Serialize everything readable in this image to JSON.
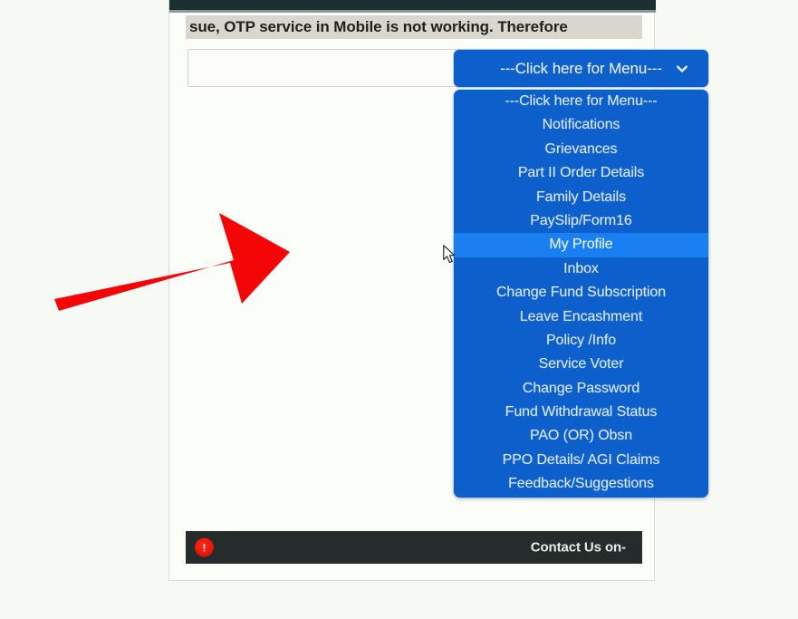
{
  "page": {
    "background_color": "#f7faf4",
    "frame_color": "#fbfdf8"
  },
  "top_strip": {
    "color": "#18302f"
  },
  "marquee": {
    "text": "sue, OTP service in Mobile is not working. Therefore",
    "background_color": "#d9d7cd",
    "text_color": "#20211e"
  },
  "select": {
    "label": "---Click here for Menu---",
    "chevron_icon": "chevron-down-icon",
    "background_color": "#0d5fcb",
    "text_color": "#e9f2fd",
    "expanded": true
  },
  "dropdown": {
    "background_color": "#0d5fcb",
    "highlight_color": "#1a7ff0",
    "selected_index": 6,
    "options": [
      {
        "label": "---Click here for Menu---"
      },
      {
        "label": "Notifications"
      },
      {
        "label": "Grievances"
      },
      {
        "label": "Part II Order Details"
      },
      {
        "label": "Family Details"
      },
      {
        "label": "PaySlip/Form16"
      },
      {
        "label": "My Profile"
      },
      {
        "label": "Inbox"
      },
      {
        "label": "Change Fund Subscription"
      },
      {
        "label": "Leave Encashment"
      },
      {
        "label": "Policy /Info"
      },
      {
        "label": "Service Voter"
      },
      {
        "label": "Change Password"
      },
      {
        "label": "Fund Withdrawal Status"
      },
      {
        "label": "PAO (OR) Obsn"
      },
      {
        "label": "PPO Details/ AGI Claims"
      },
      {
        "label": "Feedback/Suggestions"
      }
    ]
  },
  "annotation": {
    "arrow_icon": "arrow-pointing-up-right-icon",
    "arrow_color": "#f50606",
    "points_to": "My Profile"
  },
  "cursor": {
    "icon": "mouse-pointer-icon"
  },
  "footer": {
    "background_color": "#262b2b",
    "contact_text": "Contact Us on-",
    "icon": "red-circle-alert-icon",
    "icon_glyph": "!",
    "icon_color": "#e31608"
  }
}
